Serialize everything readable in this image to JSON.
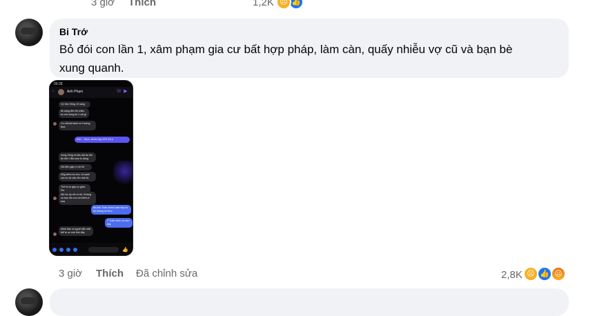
{
  "previous_comment": {
    "time": "3 giờ",
    "like_label": "Thích",
    "reaction_count": "1,2K"
  },
  "comment": {
    "author": "Bi Trớ",
    "text_line1": "Bỏ đói con lần 1, xâm phạm gia cư bất hợp pháp, làm càn, quấy nhiễu vợ cũ và bạn bè",
    "text_line2": "xung quanh.",
    "time": "3 giờ",
    "like_label": "Thích",
    "edited_label": "Đã chỉnh sửa",
    "reaction_count": "2,8K",
    "reactions": [
      "sad-icon",
      "like-icon",
      "angry-icon"
    ]
  },
  "attachment": {
    "status_time": "09:28",
    "contact_name": "Anh Phạm",
    "messages": [
      {
        "side": "in",
        "text": "Vợ đón Vũng 10 sáng"
      },
      {
        "side": "in",
        "text": "8h sáng đến đh chiều ko cho xúng ăn 1 cái gì"
      },
      {
        "side": "in",
        "text": "Có mỗi lát bánh mì Hướng đưa"
      },
      {
        "side": "out",
        "text": "Sao ... thực, và thì nay VỢ1 thì ạ"
      },
      {
        "side": "in",
        "text": "Xong Vũng về kêu đói ăn lên ăn hết 1 đĩa cơm to đúng"
      },
      {
        "side": "in",
        "text": "Nói đến gặp rc với tôi"
      },
      {
        "side": "in",
        "text": "Nhg bênh bo cho, rồi canh cạn ko đc việc lên nhà tôi"
      },
      {
        "side": "in",
        "text": "Thế là nó gây sự giữa Pie"
      },
      {
        "side": "in",
        "text": "Mờ lúc ấy chỉ có tôi, Hường và bạn thô con với bênh 8 nha"
      },
      {
        "side": "out",
        "text": "Ba bảo Tuấn check cam hay ko thì không về bà ạ"
      },
      {
        "side": "out",
        "text": "Ý Tuấn chéc có cam đây"
      },
      {
        "side": "in",
        "text": "Mình bảo ra ngoài dẫn mặt thể là nó mời thôi đây"
      }
    ]
  }
}
